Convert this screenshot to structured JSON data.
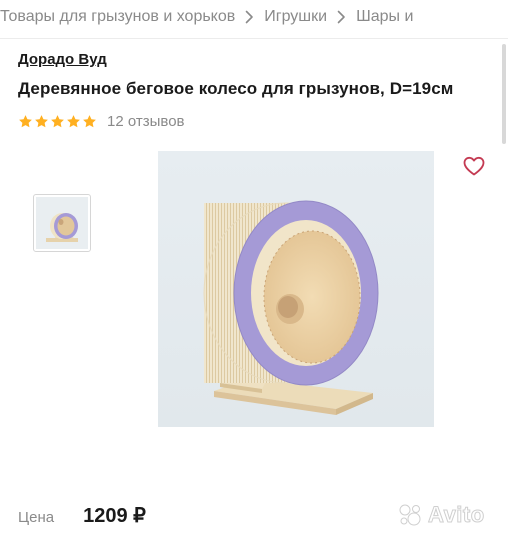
{
  "breadcrumb": {
    "items": [
      "Товары для грызунов и хорьков",
      "Игрушки",
      "Шары и"
    ]
  },
  "seller": {
    "name": "Дорадо Вуд"
  },
  "product": {
    "title": "Деревянное беговое колесо для грызунов, D=19см",
    "rating": {
      "stars": 5,
      "reviews_label": "12 отзывов"
    }
  },
  "price": {
    "label": "Цена",
    "value": "1209 ₽"
  },
  "watermark": {
    "text": "Avito"
  },
  "colors": {
    "star": "#ffb021",
    "favorite": "#c43a52",
    "wheel_rim": "#a59ad6",
    "wood": "#efe3c6"
  },
  "icons": {
    "breadcrumb_separator": "chevron-right-icon",
    "favorite": "heart-outline-icon",
    "rating_star": "star-icon"
  }
}
